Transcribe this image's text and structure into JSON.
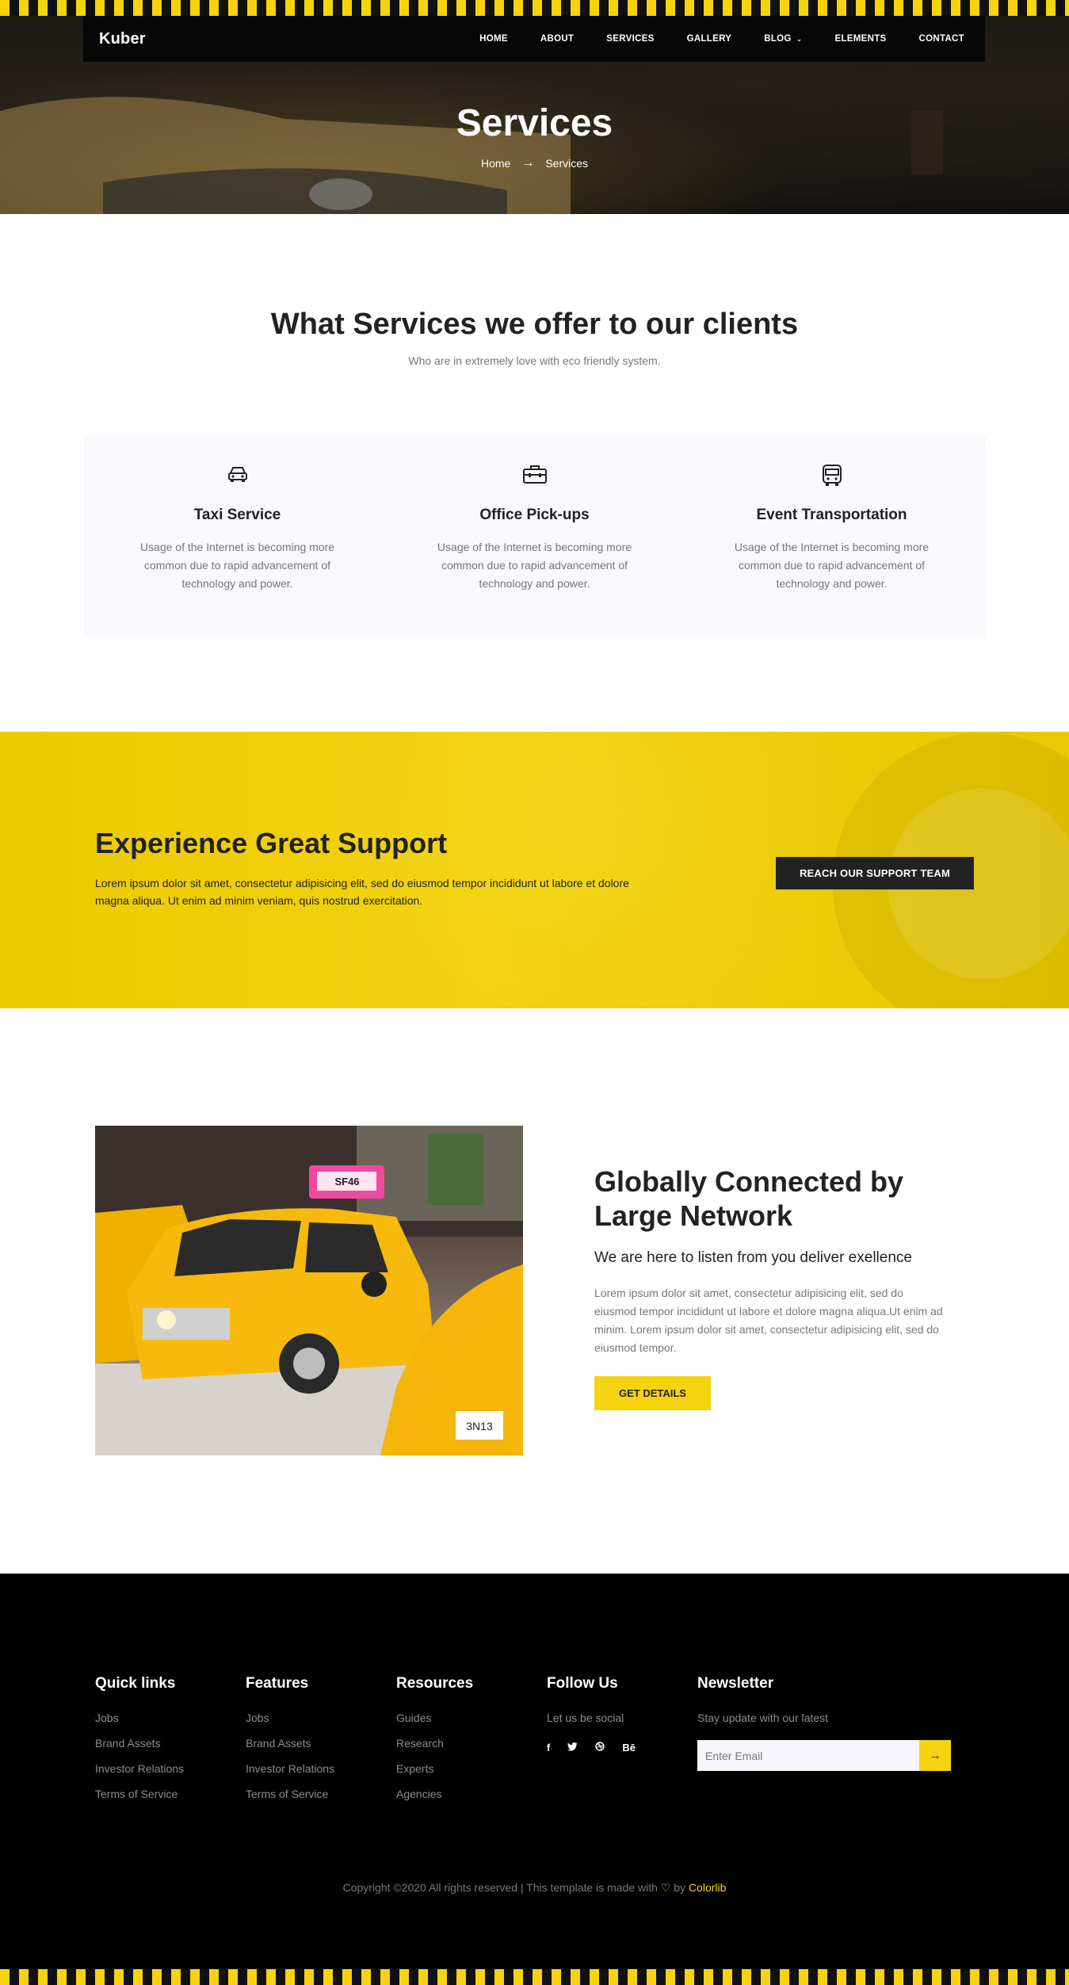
{
  "header": {
    "logo": "Kuber",
    "nav": [
      {
        "label": "HOME"
      },
      {
        "label": "ABOUT"
      },
      {
        "label": "SERVICES"
      },
      {
        "label": "GALLERY"
      },
      {
        "label": "BLOG",
        "has_dropdown": true
      },
      {
        "label": "ELEMENTS"
      },
      {
        "label": "CONTACT"
      }
    ],
    "dropdown_icon": "chevron-down-icon"
  },
  "hero": {
    "title": "Services",
    "breadcrumb": {
      "home": "Home",
      "current": "Services",
      "separator_icon": "arrow-right-icon"
    }
  },
  "services": {
    "title": "What Services we offer to our clients",
    "subtitle": "Who are in extremely love with eco friendly system.",
    "cards": [
      {
        "icon": "car-icon",
        "title": "Taxi Service",
        "text": "Usage of the Internet is becoming more common due to rapid advancement of technology and power."
      },
      {
        "icon": "briefcase-icon",
        "title": "Office Pick-ups",
        "text": "Usage of the Internet is becoming more common due to rapid advancement of technology and power."
      },
      {
        "icon": "bus-icon",
        "title": "Event Transportation",
        "text": "Usage of the Internet is becoming more common due to rapid advancement of technology and power."
      }
    ]
  },
  "support": {
    "title": "Experience Great Support",
    "text": "Lorem ipsum dolor sit amet, consectetur adipisicing elit, sed do eiusmod tempor incididunt ut labore et dolore magna aliqua. Ut enim ad minim veniam, quis nostrud exercitation.",
    "button": "REACH OUR SUPPORT TEAM"
  },
  "network": {
    "title": "Globally Connected by Large Network",
    "subtitle": "We are here to listen from you deliver exellence",
    "text": "Lorem ipsum dolor sit amet, consectetur adipisicing elit, sed do eiusmod tempor incididunt ut labore et dolore magna aliqua.Ut enim ad minim. Lorem ipsum dolor sit amet, consectetur adipisicing elit, sed do eiusmod tempor.",
    "button": "GET DETAILS",
    "image": {
      "taxi_sign": "SF46",
      "plate": "3N13"
    }
  },
  "footer": {
    "quick_links": {
      "title": "Quick links",
      "items": [
        "Jobs",
        "Brand Assets",
        "Investor Relations",
        "Terms of Service"
      ]
    },
    "features": {
      "title": "Features",
      "items": [
        "Jobs",
        "Brand Assets",
        "Investor Relations",
        "Terms of Service"
      ]
    },
    "resources": {
      "title": "Resources",
      "items": [
        "Guides",
        "Research",
        "Experts",
        "Agencies"
      ]
    },
    "follow": {
      "title": "Follow Us",
      "text": "Let us be social",
      "socials": [
        {
          "icon": "facebook-icon",
          "glyph": "f"
        },
        {
          "icon": "twitter-icon",
          "glyph": "t"
        },
        {
          "icon": "dribbble-icon",
          "glyph": "d"
        },
        {
          "icon": "behance-icon",
          "glyph": "Bē"
        }
      ]
    },
    "newsletter": {
      "title": "Newsletter",
      "text": "Stay update with our latest",
      "placeholder": "Enter Email",
      "submit_icon": "arrow-right-icon"
    },
    "copyright": {
      "before": "Copyright ©2020 All rights reserved | This template is made with",
      "by": "by",
      "brand": "Colorlib"
    }
  },
  "colors": {
    "accent": "#f5d40f",
    "dark": "#222222",
    "footer_bg": "#000000",
    "card_bg": "#f8f8fd"
  }
}
